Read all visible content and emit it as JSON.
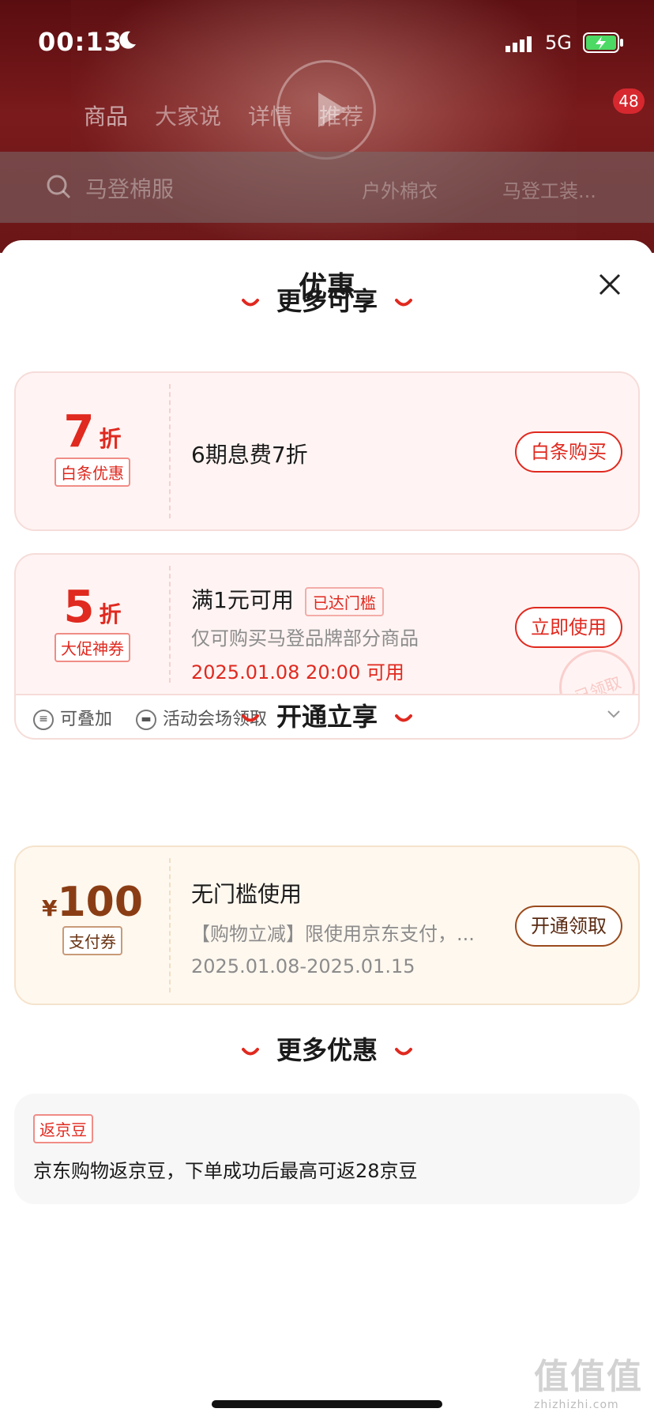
{
  "status_bar": {
    "time": "00:13",
    "network": "5G"
  },
  "background": {
    "nav_tabs": [
      "商品",
      "大家说",
      "详情",
      "推荐"
    ],
    "badge_count": "48",
    "search": {
      "placeholder": "马登棉服",
      "chips": [
        "户外棉衣",
        "马登工装..."
      ]
    }
  },
  "sheet": {
    "title": "优惠",
    "sections": {
      "more_available": "更多可享",
      "activate": "开通立享",
      "more_offers": "更多优惠"
    },
    "coupon_baitiao": {
      "value": "7",
      "unit": "折",
      "tag": "白条优惠",
      "description": "6期息费7折",
      "button": "白条购买"
    },
    "coupon_promo": {
      "value": "5",
      "unit": "折",
      "tag": "大促神券",
      "title": "满1元可用",
      "status_tag": "已达门槛",
      "scope": "仅可购买马登品牌部分商品",
      "valid_time": "2025.01.08 20:00 可用",
      "button": "立即使用",
      "stamp": "已领取",
      "footer_stackable": "可叠加",
      "footer_source": "活动会场领取"
    },
    "coupon_pay": {
      "currency": "¥",
      "value": "100",
      "tag": "支付券",
      "title": "无门槛使用",
      "detail": "【购物立减】限使用京东支付，...",
      "valid_range": "2025.01.08-2025.01.15",
      "button": "开通领取"
    },
    "jd_beans": {
      "tag": "返京豆",
      "text": "京东购物返京豆，下单成功后最高可返28京豆"
    }
  },
  "watermark": {
    "glyphs": "值值值",
    "url": "zhizhizhi.com"
  },
  "colors": {
    "accent_red": "#e0291f",
    "brown": "#8a3d14",
    "overlay": "#7a1a1c"
  }
}
